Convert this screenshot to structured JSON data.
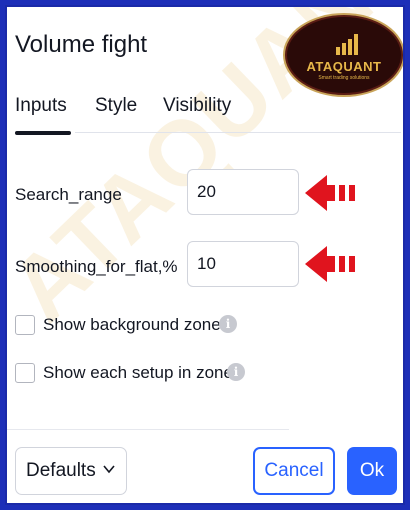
{
  "dialog": {
    "title": "Volume fight"
  },
  "logo": {
    "text": "ATAQUANT",
    "tagline": "Smart trading solutions",
    "color": "#e8b84a"
  },
  "watermark": {
    "text": "ATAQUANT"
  },
  "tabs": [
    {
      "label": "Inputs",
      "active": true
    },
    {
      "label": "Style",
      "active": false
    },
    {
      "label": "Visibility",
      "active": false
    }
  ],
  "inputs": {
    "search_range": {
      "label": "Search_range",
      "value": "20"
    },
    "smoothing": {
      "label": "Smoothing_for_flat,%",
      "value": "10"
    }
  },
  "checkboxes": [
    {
      "label": "Show background zones",
      "checked": false
    },
    {
      "label": "Show each setup in zone",
      "checked": false
    }
  ],
  "footer": {
    "defaults_label": "Defaults",
    "cancel_label": "Cancel",
    "ok_label": "Ok"
  },
  "colors": {
    "accent": "#2962ff",
    "arrow": "#e0141e",
    "border_frame": "#1d2fb8"
  }
}
